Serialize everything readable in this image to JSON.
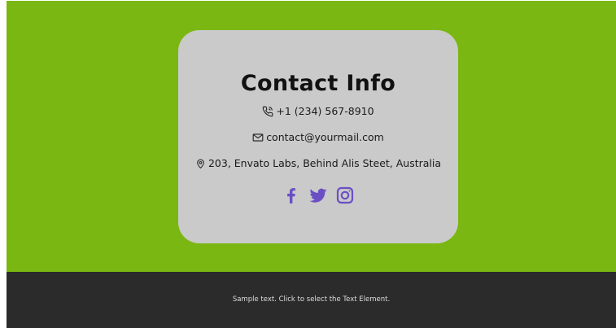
{
  "contact": {
    "title": "Contact Info",
    "phone": "+1 (234) 567-8910",
    "email": "contact@yourmail.com",
    "address": "203, Envato Labs, Behind Alis Steet, Australia",
    "icons": {
      "phone": "phone-icon",
      "email": "envelope-icon",
      "address": "map-pin-icon"
    }
  },
  "social": {
    "items": [
      {
        "name": "facebook",
        "icon": "facebook-icon"
      },
      {
        "name": "twitter",
        "icon": "twitter-icon"
      },
      {
        "name": "instagram",
        "icon": "instagram-icon"
      }
    ],
    "color": "#6a4fc4"
  },
  "footer": {
    "text": "Sample text. Click to select the Text Element."
  },
  "colors": {
    "hero_bg": "#7ab712",
    "card_bg": "#cacaca",
    "footer_bg": "#2b2b2b"
  }
}
